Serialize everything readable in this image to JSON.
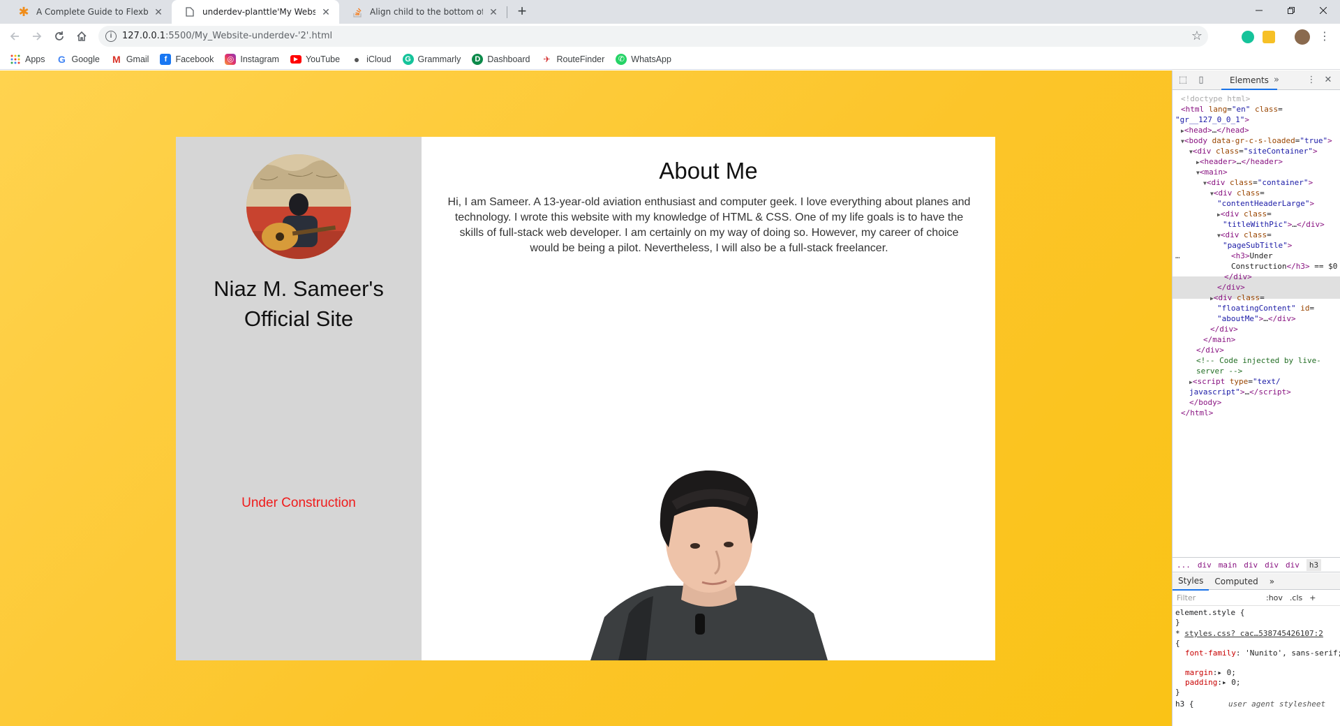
{
  "browser": {
    "tabs": [
      {
        "title": "A Complete Guide to Flexbox | C",
        "icon": "css-tricks-star-icon",
        "active": false
      },
      {
        "title": "underdev-planttle'My Website'-c",
        "icon": "page-icon",
        "active": true
      },
      {
        "title": "Align child to the bottom of the",
        "icon": "stackoverflow-icon",
        "active": false
      }
    ],
    "url_host": "127.0.0.1",
    "url_path": ":5500/My_Website-underdev-'2'.html",
    "bookmarks": [
      "Apps",
      "Google",
      "Gmail",
      "Facebook",
      "Instagram",
      "YouTube",
      "iCloud",
      "Grammarly",
      "Dashboard",
      "RouteFinder",
      "WhatsApp"
    ]
  },
  "page": {
    "site_title_line1": "Niaz M. Sameer's",
    "site_title_line2": "Official Site",
    "under_construction": "Under Construction",
    "about_title": "About Me",
    "about_text": "Hi, I am Sameer. A 13-year-old aviation enthusiast and computer geek. I love everything about planes and technology. I wrote this website with my knowledge of HTML & CSS. One of my life goals is to have the skills of full-stack web developer. I am certainly on my way of doing so. However, my career of choice would be being a pilot. Nevertheless, I will also be a full-stack freelancer."
  },
  "devtools": {
    "panel_tab": "Elements",
    "breadcrumbs": [
      "...",
      "div",
      "main",
      "div",
      "div",
      "div",
      "h3"
    ],
    "style_tabs": [
      "Styles",
      "Computed"
    ],
    "filter_placeholder": "Filter",
    "hov": ":hov",
    "cls": ".cls",
    "element_style": "element.style {",
    "rule_source": "styles.css? cac…538745426107:2",
    "rule_selector": "* ",
    "font_family": "'Nunito', sans-serif;",
    "margin": "0;",
    "padding": "0;",
    "ua_rule": "h3 {",
    "ua_label": "user agent stylesheet"
  },
  "colors": {
    "page_bg": "#fcc52a",
    "sidebar_bg": "#d6d6d6",
    "under_construction": "#ef1b1b"
  }
}
